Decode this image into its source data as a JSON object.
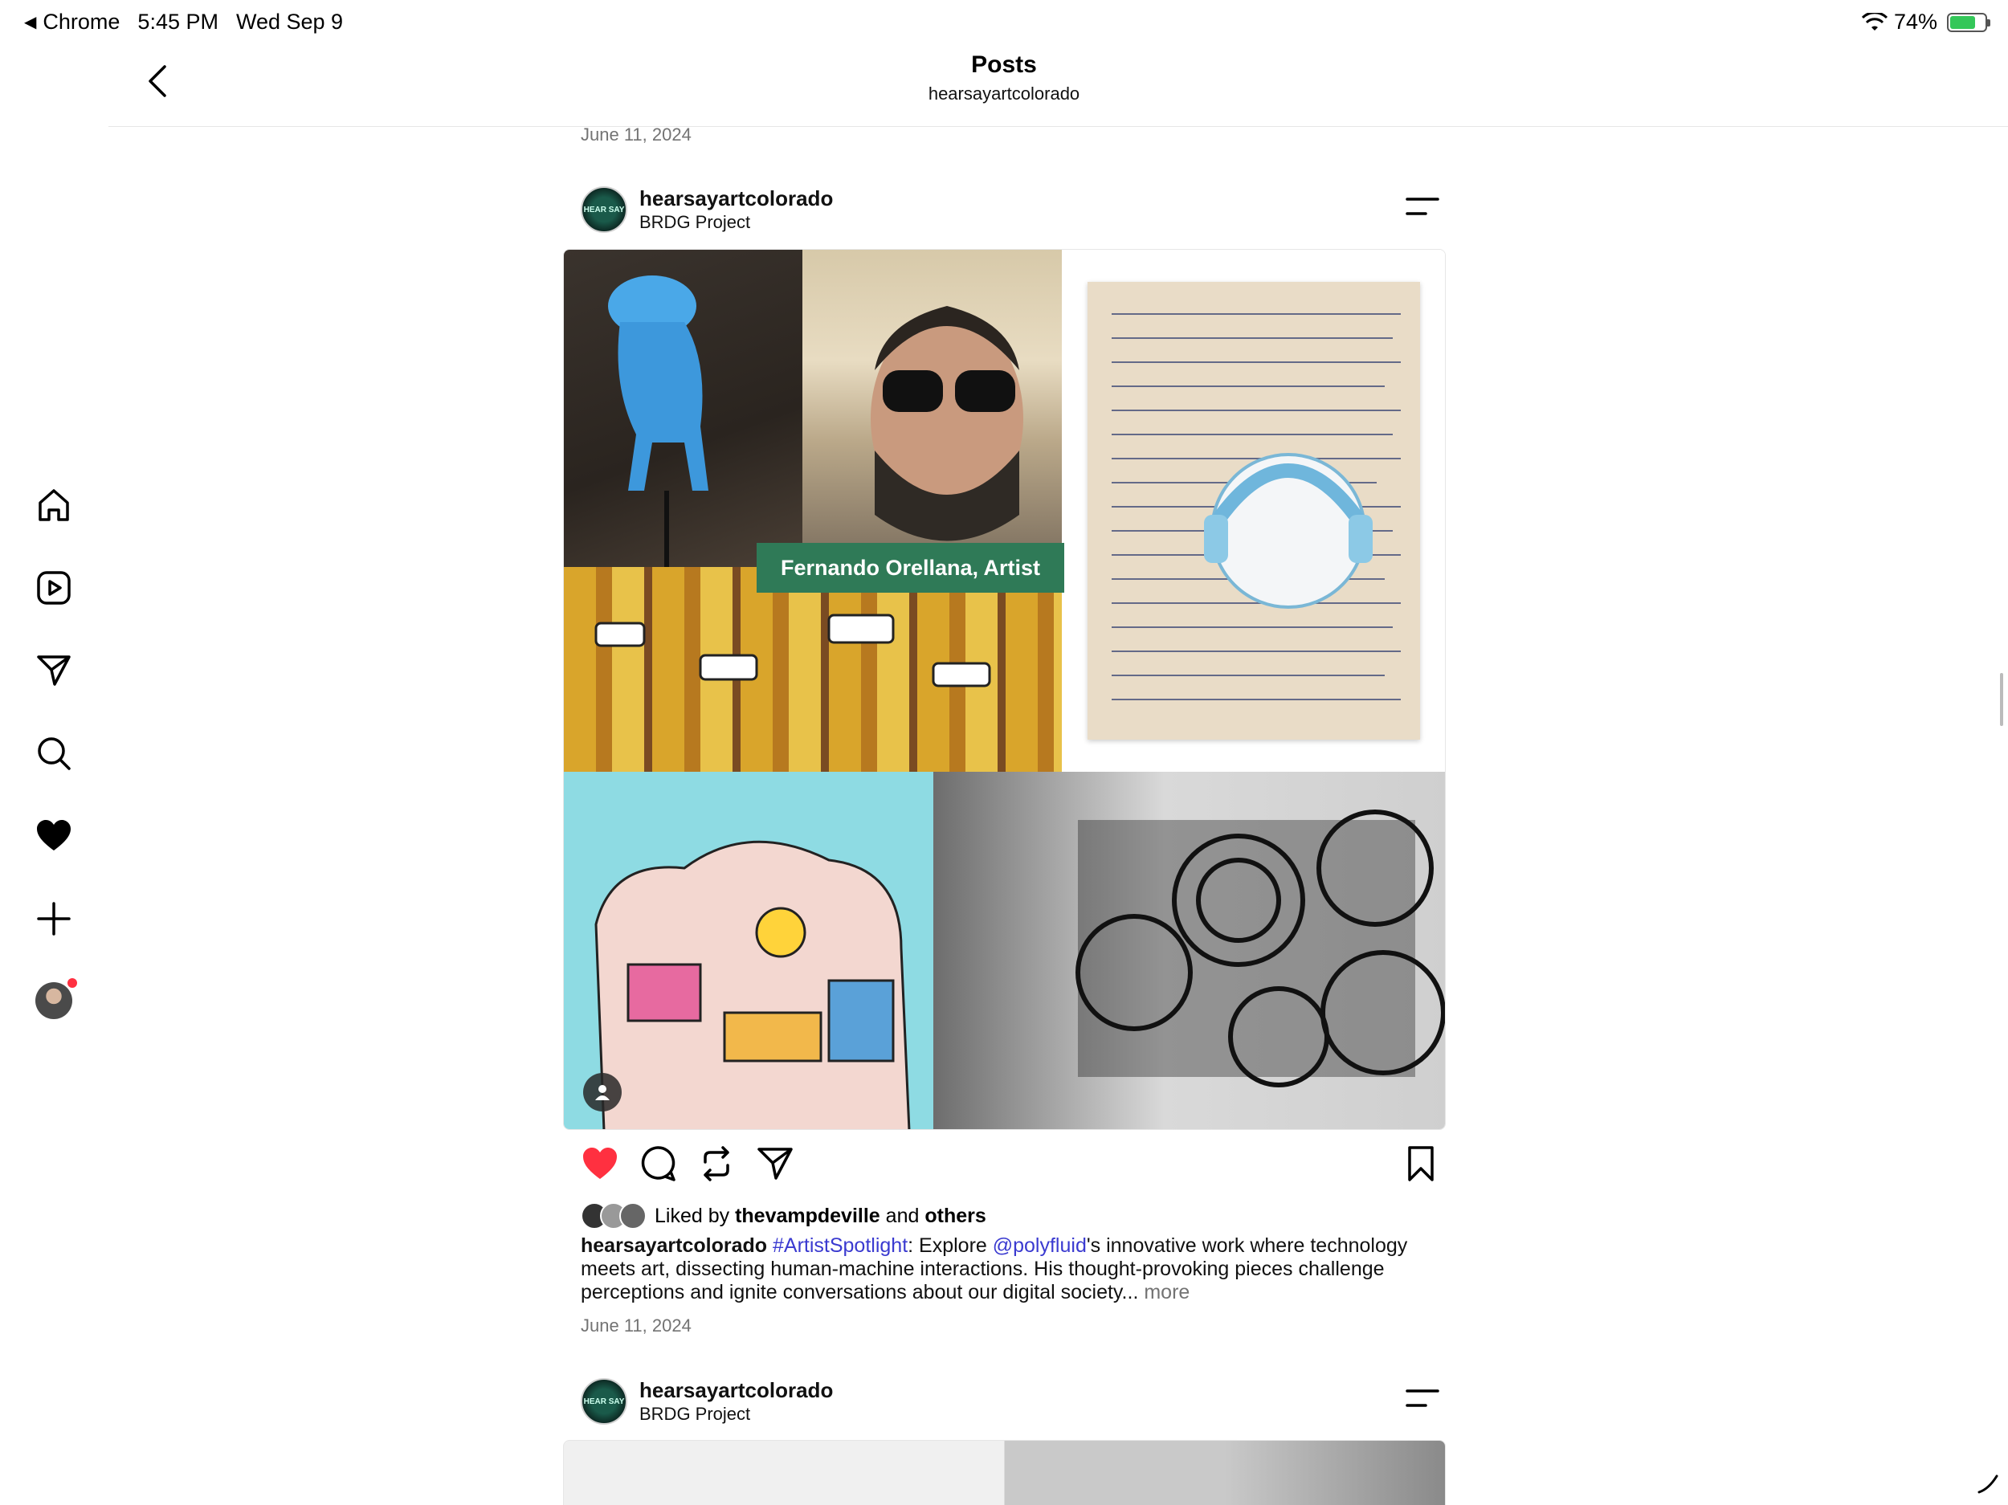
{
  "status_bar": {
    "back_app": "Chrome",
    "time": "5:45 PM",
    "date": "Wed Sep 9",
    "battery": "74%",
    "battery_level": 0.74
  },
  "header": {
    "title": "Posts",
    "subtitle": "hearsayartcolorado"
  },
  "feed": {
    "top_date": "June 11, 2024",
    "post1": {
      "username": "hearsayartcolorado",
      "location": "BRDG Project",
      "avatar_text": "HEAR SAY",
      "image_banner": "Fernando Orellana, Artist",
      "liked_by_prefix": "Liked by",
      "liked_by_user": "thevampdeville",
      "liked_by_and": "and",
      "liked_by_others": "others",
      "caption_user": "hearsayartcolorado",
      "caption_hashtag": "#ArtistSpotlight",
      "caption_part1": ": Explore ",
      "caption_mention": "@polyfluid",
      "caption_part2": "'s innovative work where technology meets art, dissecting human-machine interactions. His thought-provoking pieces challenge perceptions and ignite conversations about our digital society...",
      "more_label": "more",
      "date": "June 11, 2024",
      "liked": true
    },
    "post2": {
      "username": "hearsayartcolorado",
      "location": "BRDG Project",
      "avatar_text": "HEAR SAY"
    }
  },
  "sidebar": {
    "items": [
      "home-icon",
      "reels-icon",
      "direct-icon",
      "search-icon",
      "activity-icon",
      "create-icon",
      "profile-avatar"
    ]
  },
  "colors": {
    "like_red": "#ff3040",
    "link_blue": "#3a3ad0",
    "banner_green": "#2f7a57",
    "muted": "#737373"
  }
}
